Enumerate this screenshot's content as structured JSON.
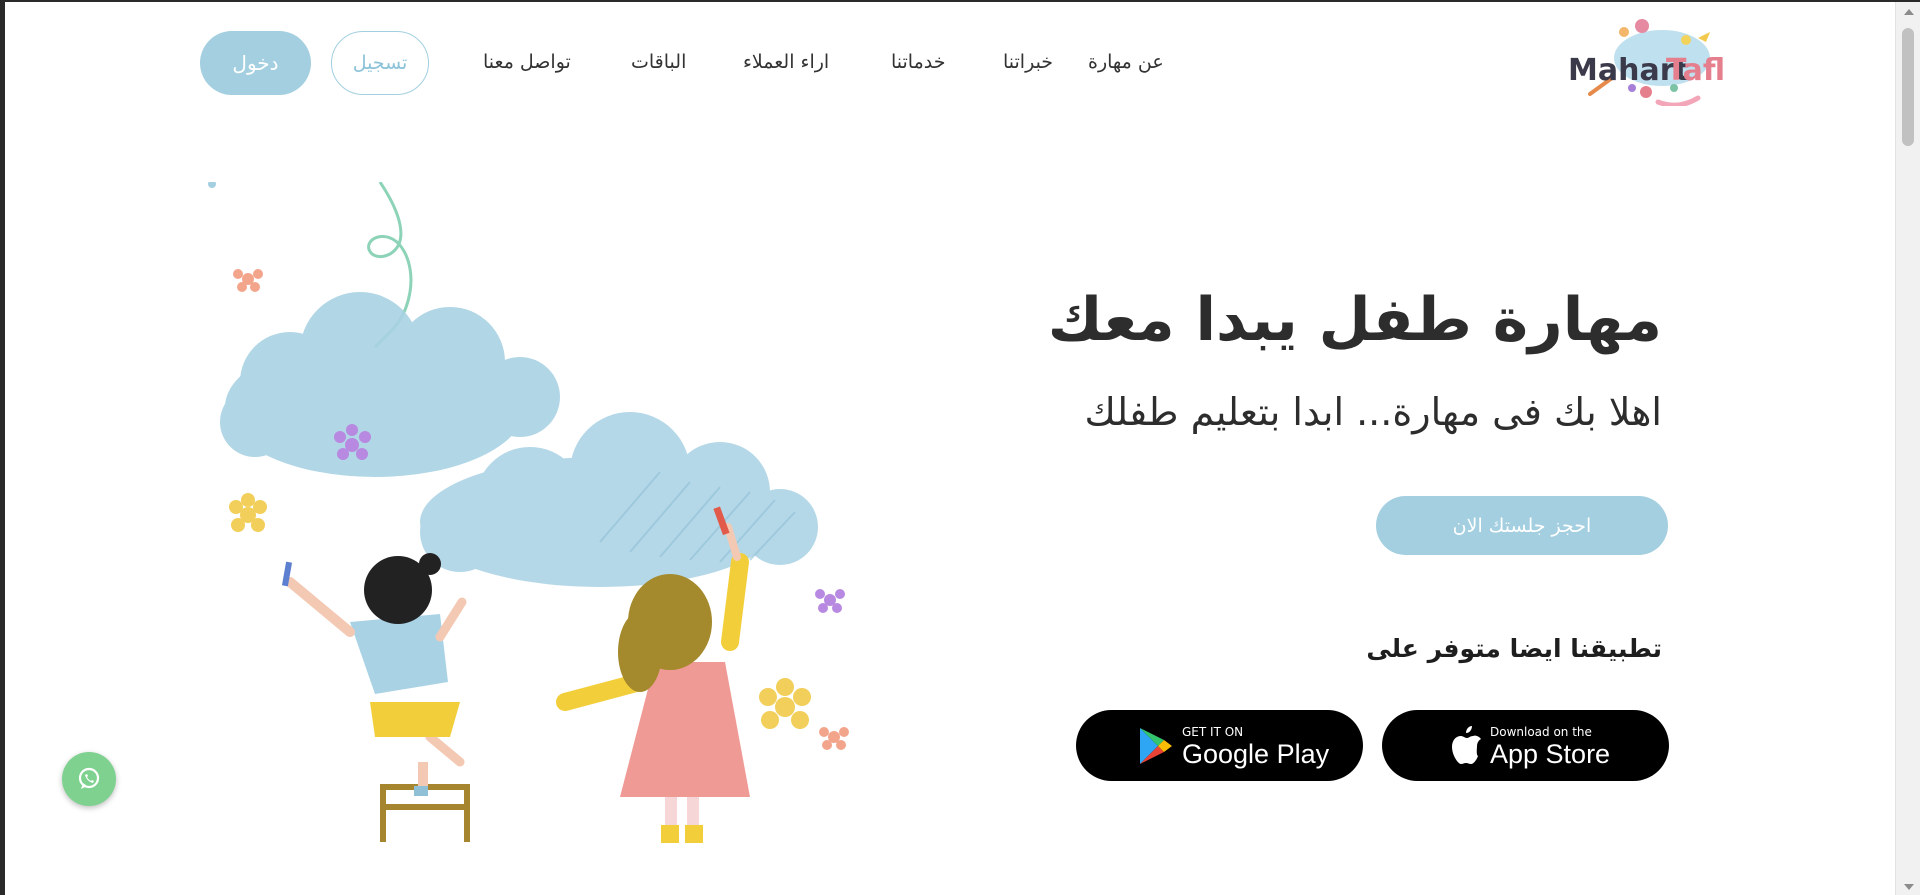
{
  "header": {
    "logo": {
      "text_part1": "Mahart",
      "text_part2": "Tafl"
    },
    "nav": [
      {
        "label": "عن مهارة"
      },
      {
        "label": "خبراتنا"
      },
      {
        "label": "خدماتنا"
      },
      {
        "label": "اراء العملاء"
      },
      {
        "label": "الباقات"
      },
      {
        "label": "تواصل معنا"
      }
    ],
    "register_label": "تسجيل",
    "login_label": "دخول"
  },
  "hero": {
    "title": "مهارة طفل يبدا معك",
    "subtitle": "اهلا بك فى مهارة... ابدا بتعليم طفلك",
    "cta_label": "احجز جلستك الان",
    "app_available": "تطبيقنا ايضا متوفر على",
    "stores": {
      "appstore": {
        "small": "Download on the",
        "big": "App Store"
      },
      "googleplay": {
        "small": "GET IT ON",
        "big": "Google Play"
      }
    }
  },
  "icons": {
    "whatsapp": "whatsapp-icon",
    "apple": "apple-icon",
    "googleplay": "google-play-icon"
  },
  "colors": {
    "accent": "#a3cfe0",
    "text": "#2d2d2d",
    "whatsapp": "#7fd190",
    "logo_dark": "#3a3a4a",
    "logo_pink": "#e57f8e"
  }
}
